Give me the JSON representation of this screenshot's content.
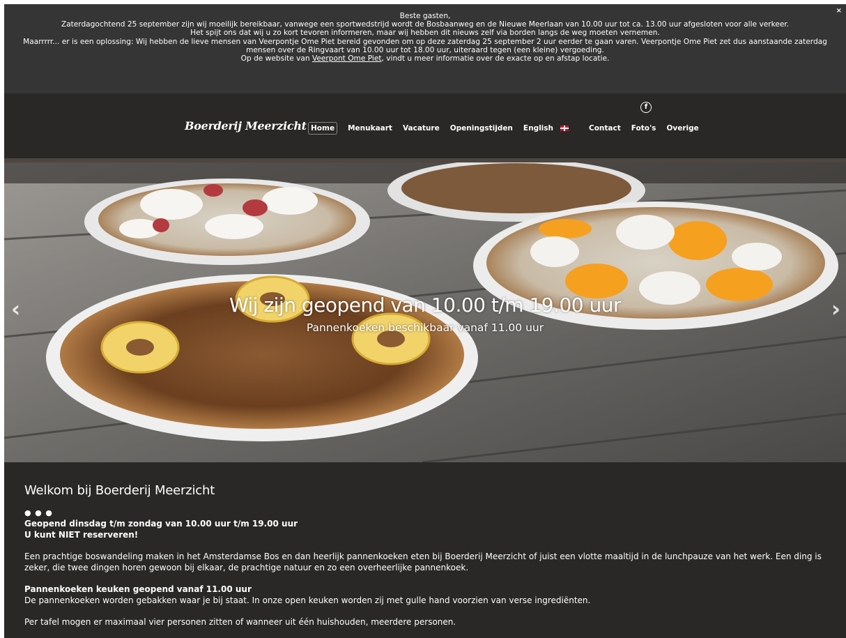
{
  "banner": {
    "greeting": "Beste gasten,",
    "line1": "Zaterdagochtend 25 september zijn wij moeilijk bereikbaar, vanwege een sportwedstrijd wordt de Bosbaanweg en de Nieuwe Meerlaan van 10.00 uur tot ca. 13.00 uur afgesloten voor alle verkeer.",
    "line2": "Het spijt ons dat wij u zo kort tevoren informeren, maar wij hebben dit nieuws zelf via borden langs de weg moeten vernemen.",
    "line3": "Maarrrrr... er is een oplossing: Wij hebben de lieve mensen van Veerpontje Ome Piet bereid gevonden om op deze zaterdag 25 september 2 uur eerder te gaan varen. Veerpontje Ome Piet zet dus aanstaande zaterdag mensen over de Ringvaart van 10.00 uur tot 18.00 uur, uiteraard tegen (een kleine) vergoeding.",
    "line4_prefix": "Op de website van ",
    "line4_link": "Veerpont Ome Piet",
    "line4_suffix": ", vindt u meer informatie over de exacte op en afstap locatie.",
    "close_label": "×"
  },
  "header": {
    "logo": "Boerderij Meerzicht",
    "facebook_icon": "f",
    "nav": [
      {
        "label": "Home",
        "active": true
      },
      {
        "label": "Menukaart"
      },
      {
        "label": "Vacature"
      },
      {
        "label": "Openingstijden"
      },
      {
        "label": "English"
      },
      {
        "label": "Contact"
      },
      {
        "label": "Foto's"
      },
      {
        "label": "Overige"
      }
    ]
  },
  "hero": {
    "title": "Wij zijn geopend van 10.00 t/m 19.00 uur",
    "subtitle": "Pannenkoeken beschikbaar vanaf 11.00 uur",
    "prev": "‹",
    "next": "›"
  },
  "content": {
    "heading": "Welkom bij Boerderij Meerzicht",
    "dots": "● ● ●",
    "hours": "Geopend dinsdag t/m zondag van 10.00 uur t/m 19.00 uur",
    "no_reservations": "U kunt NIET reserveren!",
    "intro": "Een prachtige boswandeling maken in het Amsterdamse Bos en dan heerlijk pannenkoeken eten bij Boerderij Meerzicht of juist een vlotte maaltijd in de lunchpauze van het werk. Een ding is zeker, die twee dingen horen gewoon bij elkaar, de prachtige natuur en zo een overheerlijke pannenkoek.",
    "kitchen_heading": "Pannenkoeken keuken geopend vanaf 11.00 uur",
    "kitchen_text": "De pannenkoeken worden gebakken waar je bij staat. In onze open keuken worden zij met gulle hand voorzien van verse ingrediënten.",
    "table_text": "Per tafel mogen er maximaal vier personen zitten of wanneer uit één huishouden, meerdere personen."
  }
}
